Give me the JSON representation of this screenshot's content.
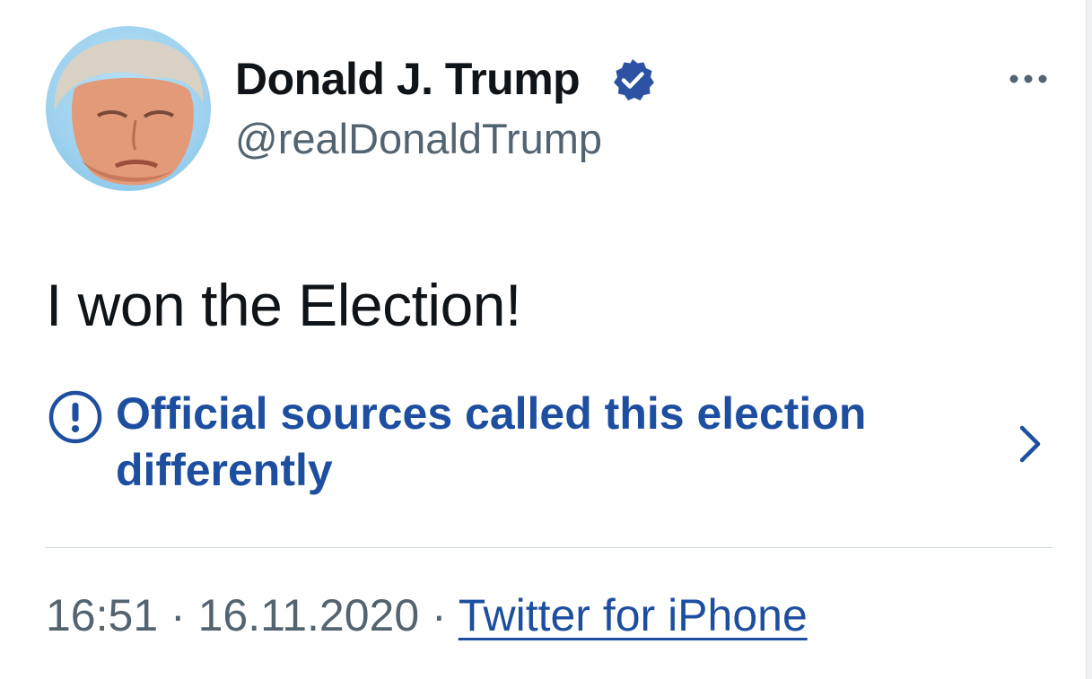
{
  "profile": {
    "display_name": "Donald J. Trump",
    "handle": "@realDonaldTrump",
    "verified": true,
    "avatar_icon": "profile-photo"
  },
  "menu": {
    "icon": "more-options-icon"
  },
  "tweet": {
    "text": "I won the Election!"
  },
  "notice": {
    "icon": "exclamation-circle-icon",
    "text": "Official sources called this election differently",
    "chevron_icon": "chevron-right-icon"
  },
  "meta": {
    "time": "16:51",
    "separator": "·",
    "date": "16.11.2020",
    "source": "Twitter for iPhone"
  },
  "colors": {
    "text_primary": "#0f1419",
    "text_secondary": "#536471",
    "link_blue": "#1d4ea0",
    "verified_blue": "#2d51a3",
    "divider": "#cfd9de"
  }
}
